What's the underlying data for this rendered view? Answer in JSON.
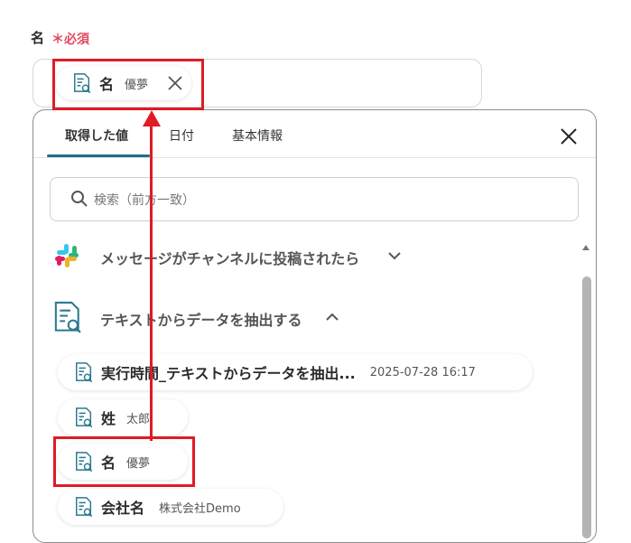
{
  "field": {
    "label": "名",
    "required": "＊必須",
    "selected_chip": {
      "key": "名",
      "value": "優夢"
    }
  },
  "tabs": [
    {
      "label": "取得した値",
      "active": true
    },
    {
      "label": "日付",
      "active": false
    },
    {
      "label": "基本情報",
      "active": false
    }
  ],
  "search": {
    "placeholder": "検索（前方一致）"
  },
  "sections": [
    {
      "label": "メッセージがチャンネルに投稿されたら",
      "icon": "slack-icon",
      "expanded": false
    },
    {
      "label": "テキストからデータを抽出する",
      "icon": "document-search-icon",
      "expanded": true
    }
  ],
  "items": [
    {
      "key": "実行時間_テキストからデータを抽出...",
      "value": "2025-07-28 16:17"
    },
    {
      "key": "姓",
      "value": "太郎"
    },
    {
      "key": "名",
      "value": "優夢"
    },
    {
      "key": "会社名",
      "value": "株式会社Demo"
    }
  ],
  "colors": {
    "accent": "#1e6e84",
    "required": "#e5495e",
    "highlight": "#e01b24",
    "icon": "#2a7a8e"
  }
}
